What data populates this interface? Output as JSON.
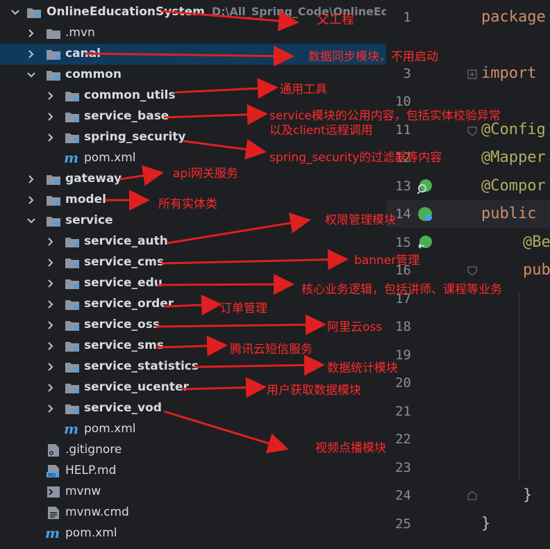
{
  "project": {
    "root_name": "OnlineEducationSystem",
    "root_path": "D:\\All_Spring_Code\\OnlineEduc"
  },
  "tree": [
    {
      "name": ".mvn",
      "kind": "folder"
    },
    {
      "name": "canal",
      "kind": "folder"
    },
    {
      "name": "common",
      "kind": "folder"
    },
    {
      "name": "common_utils",
      "kind": "folder"
    },
    {
      "name": "service_base",
      "kind": "folder"
    },
    {
      "name": "spring_security",
      "kind": "folder"
    },
    {
      "name": "pom.xml",
      "kind": "maven"
    },
    {
      "name": "gateway",
      "kind": "folder"
    },
    {
      "name": "model",
      "kind": "folder"
    },
    {
      "name": "service",
      "kind": "folder"
    },
    {
      "name": "service_auth",
      "kind": "folder"
    },
    {
      "name": "service_cms",
      "kind": "folder"
    },
    {
      "name": "service_edu",
      "kind": "folder"
    },
    {
      "name": "service_order",
      "kind": "folder"
    },
    {
      "name": "service_oss",
      "kind": "folder"
    },
    {
      "name": "service_sms",
      "kind": "folder"
    },
    {
      "name": "service_statistics",
      "kind": "folder"
    },
    {
      "name": "service_ucenter",
      "kind": "folder"
    },
    {
      "name": "service_vod",
      "kind": "folder"
    },
    {
      "name": "pom.xml",
      "kind": "maven"
    },
    {
      "name": ".gitignore",
      "kind": "gitignore"
    },
    {
      "name": "HELP.md",
      "kind": "md"
    },
    {
      "name": "mvnw",
      "kind": "shell"
    },
    {
      "name": "mvnw.cmd",
      "kind": "text"
    },
    {
      "name": "pom.xml",
      "kind": "maven"
    }
  ],
  "annotations": [
    "父工程",
    "数据同步模块，不用启动",
    "通用工具",
    "service模块的公用内容，包括实体校验异常",
    "以及client远程调用",
    "spring_security的过滤器等内容",
    "api网关服务",
    "所有实体类",
    "权限管理模块",
    "banner管理",
    "核心业务逻辑，包括讲师、课程等业务",
    "订单管理",
    "阿里云oss",
    "腾讯云短信服务",
    "数据统计模块",
    "用户获取数据模块",
    "视频点播模块"
  ],
  "editor": {
    "line_numbers": [
      "1",
      "3",
      "10",
      "11",
      "12",
      "13",
      "14",
      "15",
      "16",
      "17",
      "18",
      "19",
      "20",
      "21",
      "22",
      "23",
      "24",
      "25"
    ],
    "code": {
      "package": "package",
      "import": "import",
      "config": "@Config",
      "mapper": "@Mapper",
      "compon": "@Compor",
      "public": "public",
      "be": "@Be",
      "pub": "pub",
      "brace_inner": "}",
      "brace_outer": "}"
    }
  },
  "colors": {
    "background": "#1e1f22",
    "selection": "#0f3a5c",
    "annotation_red": "#ff2b2b",
    "folder_icon": "#8d96a2",
    "module_badge": "#4aa0e6"
  }
}
